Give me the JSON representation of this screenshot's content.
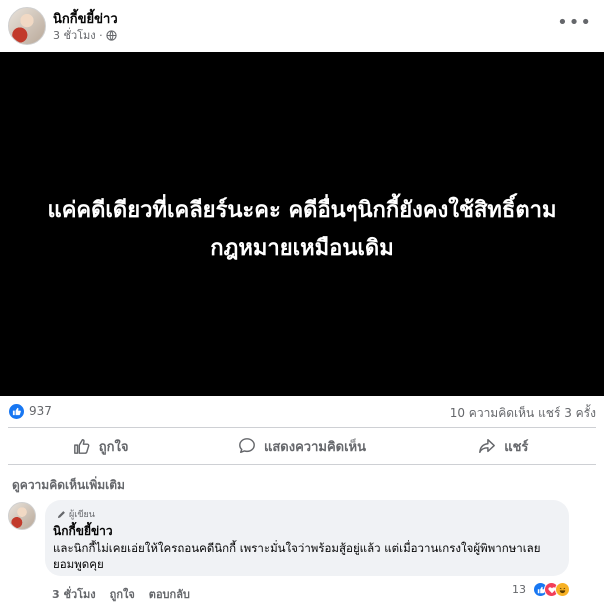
{
  "post": {
    "author": "นิกกี้ขยี้ข่าว",
    "time": "3 ชั่วโมง ·",
    "more_icon": "more-horizontal-icon",
    "image_text": "แค่คดีเดียวที่เคลียร์นะคะ คดีอื่นๆนิกกี้ยังคงใช้สิทธิ์ตามกฎหมายเหมือนเดิม"
  },
  "stats": {
    "likes": "937",
    "comments_shares": "10 ความคิดเห็น  แชร์ 3 ครั้ง"
  },
  "actions": {
    "like": "ถูกใจ",
    "comment": "แสดงความคิดเห็น",
    "share": "แชร์"
  },
  "comments": {
    "view_more": "ดูความคิดเห็นเพิ่มเติม",
    "item": {
      "badge": "ผู้เขียน",
      "name": "นิกกี้ขยี้ข่าว",
      "text": "และนิกกี้ไม่เคยเอ่ยให้ใครถอนคดีนิกกี้ เพราะมั่นใจว่าพร้อมสู้อยู่แล้ว แต่เมื่อวานเกรงใจผู้พิพากษาเลยยอมพูดคุย",
      "time": "3 ชั่วโมง",
      "like": "ถูกใจ",
      "reply": "ตอบกลับ",
      "reaction_count": "13"
    }
  },
  "colors": {
    "accent": "#1877f2",
    "love": "#f33e58",
    "haha": "#f7b125"
  }
}
